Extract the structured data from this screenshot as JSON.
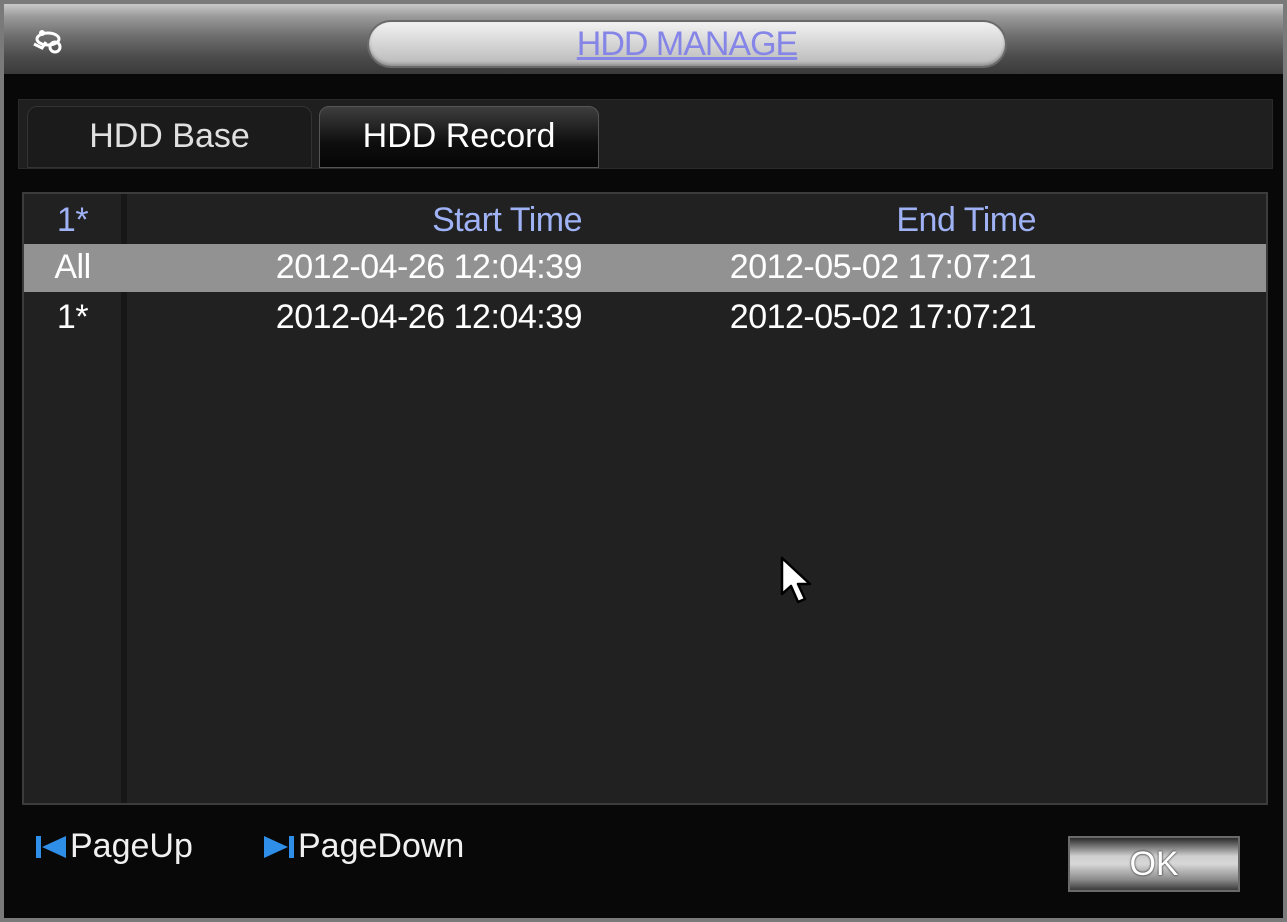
{
  "window": {
    "title": "HDD MANAGE",
    "title_icon": "hdd-settings-icon"
  },
  "tabs": [
    {
      "label": "HDD Base",
      "active": false
    },
    {
      "label": "HDD Record",
      "active": true
    }
  ],
  "table": {
    "headers": {
      "index": "1*",
      "start": "Start Time",
      "end": "End Time"
    },
    "rows": [
      {
        "index": "All",
        "start": "2012-04-26 12:04:39",
        "end": "2012-05-02 17:07:21",
        "selected": true
      },
      {
        "index": "1*",
        "start": "2012-04-26 12:04:39",
        "end": "2012-05-02 17:07:21",
        "selected": false
      }
    ]
  },
  "footer": {
    "page_up_label": "PageUp",
    "page_up_icon": "page-up-icon",
    "page_down_label": "PageDown",
    "page_down_icon": "page-down-icon",
    "ok_label": "OK"
  },
  "colors": {
    "header_text": "#9fb2f5",
    "title_text": "#8585e8",
    "selected_row": "#929292",
    "page_icon": "#2f8fe8"
  }
}
